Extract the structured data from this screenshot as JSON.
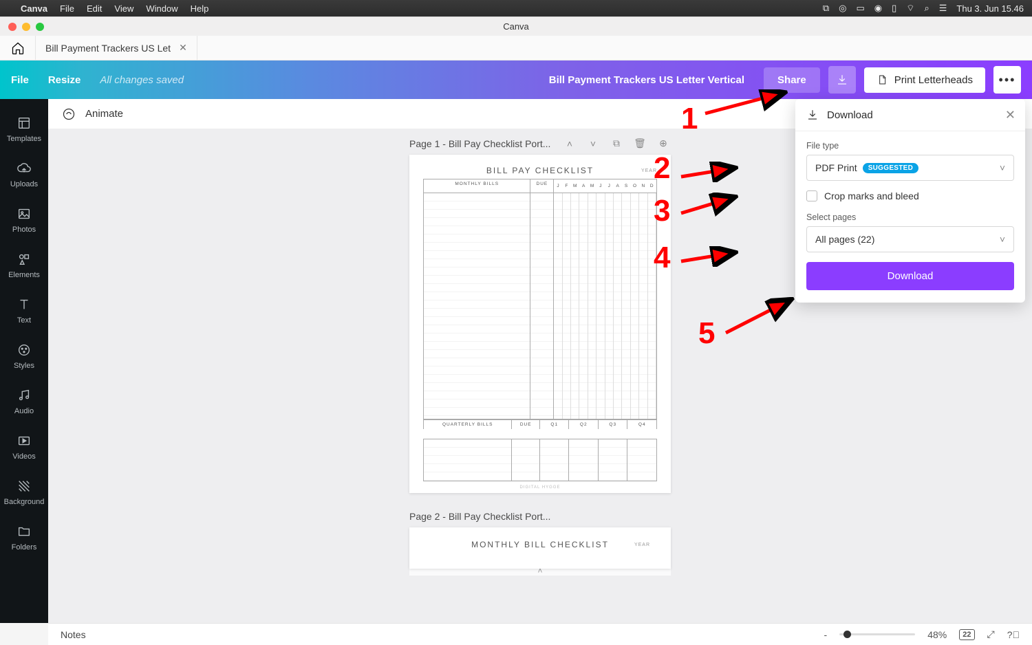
{
  "menubar": {
    "app": "Canva",
    "items": [
      "File",
      "Edit",
      "View",
      "Window",
      "Help"
    ],
    "clock": "Thu 3. Jun  15.46"
  },
  "window_title": "Canva",
  "tab": {
    "title": "Bill Payment Trackers US Let"
  },
  "actionbar": {
    "file": "File",
    "resize": "Resize",
    "saved": "All changes saved",
    "doc_title": "Bill Payment Trackers US Letter Vertical",
    "share": "Share",
    "print": "Print Letterheads"
  },
  "context": {
    "animate": "Animate"
  },
  "sidepanel": [
    "Templates",
    "Uploads",
    "Photos",
    "Elements",
    "Text",
    "Styles",
    "Audio",
    "Videos",
    "Background",
    "Folders"
  ],
  "page1": {
    "label": "Page 1 - Bill Pay Checklist Port...",
    "heading": "BILL PAY CHECKLIST",
    "year": "YEAR",
    "cols_main": "MONTHLY BILLS",
    "cols_due": "DUE",
    "months": [
      "J",
      "F",
      "M",
      "A",
      "M",
      "J",
      "J",
      "A",
      "S",
      "O",
      "N",
      "D"
    ],
    "q_heading": "QUARTERLY BILLS",
    "q_due": "DUE",
    "quarters": [
      "Q1",
      "Q2",
      "Q3",
      "Q4"
    ],
    "brand": "DIGITAL HYGGE"
  },
  "page2": {
    "label": "Page 2 - Bill Pay Checklist Port...",
    "heading": "MONTHLY BILL CHECKLIST",
    "year": "YEAR"
  },
  "panel": {
    "title": "Download",
    "file_type_label": "File type",
    "file_type_value": "PDF Print",
    "badge": "SUGGESTED",
    "crop": "Crop marks and bleed",
    "select_pages_label": "Select pages",
    "select_pages_value": "All pages (22)",
    "button": "Download"
  },
  "annotations": {
    "n1": "1",
    "n2": "2",
    "n3": "3",
    "n4": "4",
    "n5": "5"
  },
  "status": {
    "notes": "Notes",
    "zoom": "48%",
    "pages": "22"
  }
}
